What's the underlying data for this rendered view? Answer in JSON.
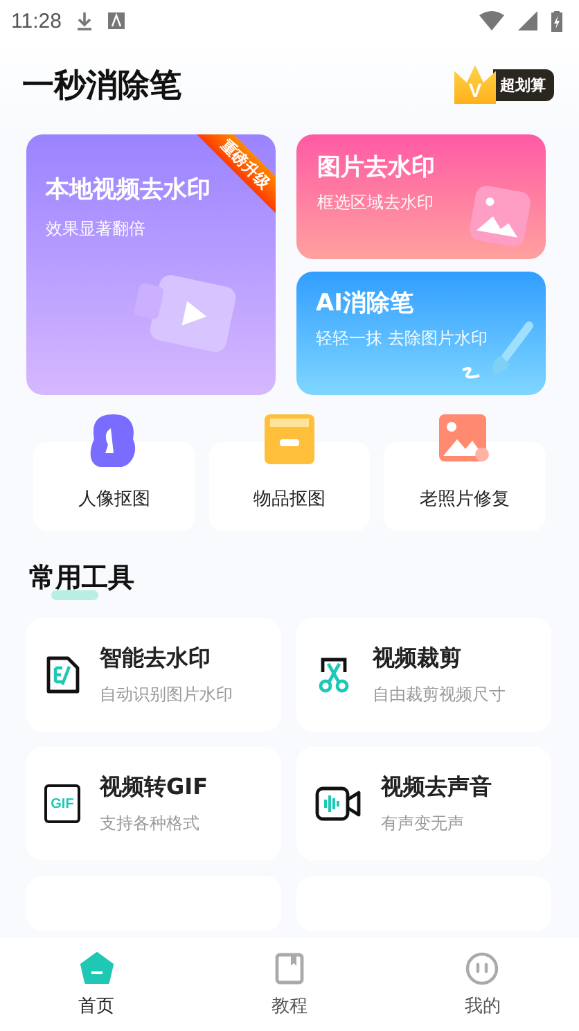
{
  "status_bar": {
    "time": "11:28"
  },
  "header": {
    "title": "一秒消除笔",
    "vip_badge": "超划算",
    "vip_letter": "V"
  },
  "feature_cards": [
    {
      "kind": "large",
      "title": "本地视频去水印",
      "subtitle": "效果显著翻倍",
      "ribbon": "重磅升级"
    },
    {
      "kind": "photo",
      "title": "图片去水印",
      "subtitle": "框选区域去水印"
    },
    {
      "kind": "brush",
      "title": "AI消除笔",
      "subtitle": "轻轻一抹 去除图片水印"
    }
  ],
  "quick_tools": [
    {
      "kind": "portrait",
      "label": "人像抠图"
    },
    {
      "kind": "box",
      "label": "物品抠图"
    },
    {
      "kind": "photo",
      "label": "老照片修复"
    }
  ],
  "section_title": "常用工具",
  "tools": [
    {
      "kind": "watermark",
      "title": "智能去水印",
      "subtitle": "自动识别图片水印"
    },
    {
      "kind": "crop",
      "title": "视频裁剪",
      "subtitle": "自由裁剪视频尺寸"
    },
    {
      "kind": "gif",
      "title": "视频转GIF",
      "subtitle": "支持各种格式",
      "icon_text": "GIF"
    },
    {
      "kind": "mute",
      "title": "视频去声音",
      "subtitle": "有声变无声"
    },
    {
      "kind": "partial"
    },
    {
      "kind": "partial"
    }
  ],
  "nav": [
    {
      "kind": "home",
      "label": "首页",
      "selected": true
    },
    {
      "kind": "book",
      "label": "教程",
      "selected": false
    },
    {
      "kind": "face",
      "label": "我的",
      "selected": false
    }
  ]
}
